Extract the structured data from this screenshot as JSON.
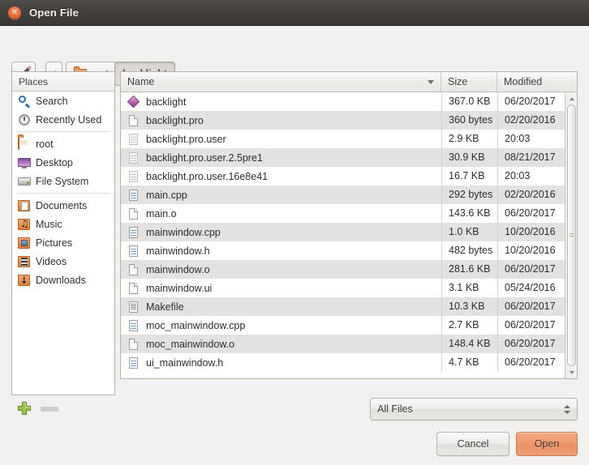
{
  "window": {
    "title": "Open File",
    "close_icon": "close-icon"
  },
  "toolbar": {
    "edit_path_icon": "pencil-icon",
    "back_icon": "chevron-left-icon",
    "path_buttons": [
      {
        "label": "root",
        "icon": "home-folder-icon",
        "active": false
      },
      {
        "label": "backlight",
        "icon": "",
        "active": true
      }
    ]
  },
  "places": {
    "header": "Places",
    "items": [
      {
        "label": "Search",
        "icon": "search-icon"
      },
      {
        "label": "Recently Used",
        "icon": "recent-icon"
      },
      {
        "label": "root",
        "icon": "home-folder-icon"
      },
      {
        "label": "Desktop",
        "icon": "desktop-icon"
      },
      {
        "label": "File System",
        "icon": "drive-icon"
      },
      {
        "label": "Documents",
        "icon": "documents-folder-icon"
      },
      {
        "label": "Music",
        "icon": "music-folder-icon"
      },
      {
        "label": "Pictures",
        "icon": "pictures-folder-icon"
      },
      {
        "label": "Videos",
        "icon": "videos-folder-icon"
      },
      {
        "label": "Downloads",
        "icon": "downloads-folder-icon"
      }
    ],
    "add_icon": "plus-icon",
    "remove_icon": "minus-icon"
  },
  "filelist": {
    "columns": [
      "Name",
      "Size",
      "Modified"
    ],
    "sort_column": "Name",
    "sort_icon": "sort-descending-icon",
    "rows": [
      {
        "name": "backlight",
        "size": "367.0 KB",
        "modified": "06/20/2017",
        "icon": "executable-file-icon"
      },
      {
        "name": "backlight.pro",
        "size": "360 bytes",
        "modified": "02/20/2016",
        "icon": "blank-file-icon"
      },
      {
        "name": "backlight.pro.user",
        "size": "2.9 KB",
        "modified": "20:03",
        "icon": "user-file-icon"
      },
      {
        "name": "backlight.pro.user.2.5pre1",
        "size": "30.9 KB",
        "modified": "08/21/2017",
        "icon": "user-file-icon"
      },
      {
        "name": "backlight.pro.user.16e8e41",
        "size": "16.7 KB",
        "modified": "20:03",
        "icon": "user-file-icon"
      },
      {
        "name": "main.cpp",
        "size": "292 bytes",
        "modified": "02/20/2016",
        "icon": "code-file-icon"
      },
      {
        "name": "main.o",
        "size": "143.6 KB",
        "modified": "06/20/2017",
        "icon": "blank-file-icon"
      },
      {
        "name": "mainwindow.cpp",
        "size": "1.0 KB",
        "modified": "10/20/2016",
        "icon": "code-file-icon"
      },
      {
        "name": "mainwindow.h",
        "size": "482 bytes",
        "modified": "10/20/2016",
        "icon": "code-file-icon"
      },
      {
        "name": "mainwindow.o",
        "size": "281.6 KB",
        "modified": "06/20/2017",
        "icon": "blank-file-icon"
      },
      {
        "name": "mainwindow.ui",
        "size": "3.1 KB",
        "modified": "05/24/2016",
        "icon": "blank-file-icon"
      },
      {
        "name": "Makefile",
        "size": "10.3 KB",
        "modified": "06/20/2017",
        "icon": "makefile-icon"
      },
      {
        "name": "moc_mainwindow.cpp",
        "size": "2.7 KB",
        "modified": "06/20/2017",
        "icon": "code-file-icon"
      },
      {
        "name": "moc_mainwindow.o",
        "size": "148.4 KB",
        "modified": "06/20/2017",
        "icon": "blank-file-icon"
      },
      {
        "name": "ui_mainwindow.h",
        "size": "4.7 KB",
        "modified": "06/20/2017",
        "icon": "code-file-icon"
      }
    ]
  },
  "footer": {
    "filter_selected": "All Files",
    "cancel_label": "Cancel",
    "open_label": "Open"
  },
  "colors": {
    "titlebar": "#433f3c",
    "window_bg": "#f2f1f0",
    "accent_open_button": "#ef9a70",
    "close_button": "#e86f3a",
    "row_alt": "#e3e2e0"
  }
}
